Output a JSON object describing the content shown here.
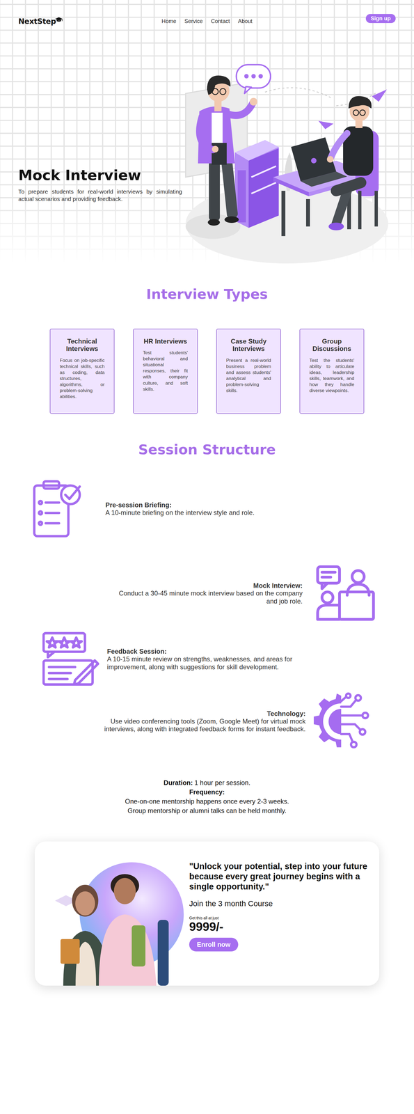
{
  "nav": {
    "logo": "NextStep",
    "links": [
      {
        "label": "Home"
      },
      {
        "label": "Service"
      },
      {
        "label": "Contact"
      },
      {
        "label": "About"
      }
    ],
    "signup": "Sign up"
  },
  "hero": {
    "title": "Mock Interview",
    "description": "To prepare students for real-world interviews by simulating actual scenarios and providing feedback."
  },
  "interview_types": {
    "heading": "Interview Types",
    "cards": [
      {
        "title": "Technical Interviews",
        "text": "Focus on job-specific technical skills, such as coding, data structures, algorithms, or problem-solving abilities."
      },
      {
        "title": "HR Interviews",
        "text": "Test students' behavioral and situational responses, their fit with company culture, and soft skills."
      },
      {
        "title": "Case Study Interviews",
        "text": "Present a real-world business problem and assess students' analytical and problem-solving skills."
      },
      {
        "title": "Group Discussions",
        "text": "Test the students' ability to articulate ideas, leadership skills, teamwork, and how they handle diverse viewpoints."
      }
    ]
  },
  "session": {
    "heading": "Session Structure",
    "steps": [
      {
        "title": "Pre-session Briefing:",
        "text": "A 10-minute briefing on the interview style and role.",
        "kind": "left"
      },
      {
        "title": "Mock Interview:",
        "text": "Conduct a 30-45 minute mock interview based on the company and job role.",
        "kind": "right"
      },
      {
        "title": "Feedback Session:",
        "text": "A 10-15 minute review on strengths, weaknesses, and areas for improvement, along with suggestions for skill development.",
        "kind": "left"
      },
      {
        "title": "Technology:",
        "text": "Use video conferencing tools (Zoom, Google Meet) for virtual mock interviews, along with integrated feedback forms for instant feedback.",
        "kind": "right"
      }
    ]
  },
  "schedule": {
    "duration_label": "Duration:",
    "duration": "1 hour per session.",
    "frequency_label": "Frequency:",
    "lines": [
      "One-on-one mentorship happens once every 2-3 weeks.",
      "Group mentorship or alumni talks can be held monthly."
    ]
  },
  "cta": {
    "quote": "\"Unlock your potential, step into your future because every great journey begins with a single opportunity.\"",
    "course": "Join the 3 month Course",
    "price_label": "Get this all at just",
    "price": "9999/-",
    "button": "Enroll now"
  }
}
